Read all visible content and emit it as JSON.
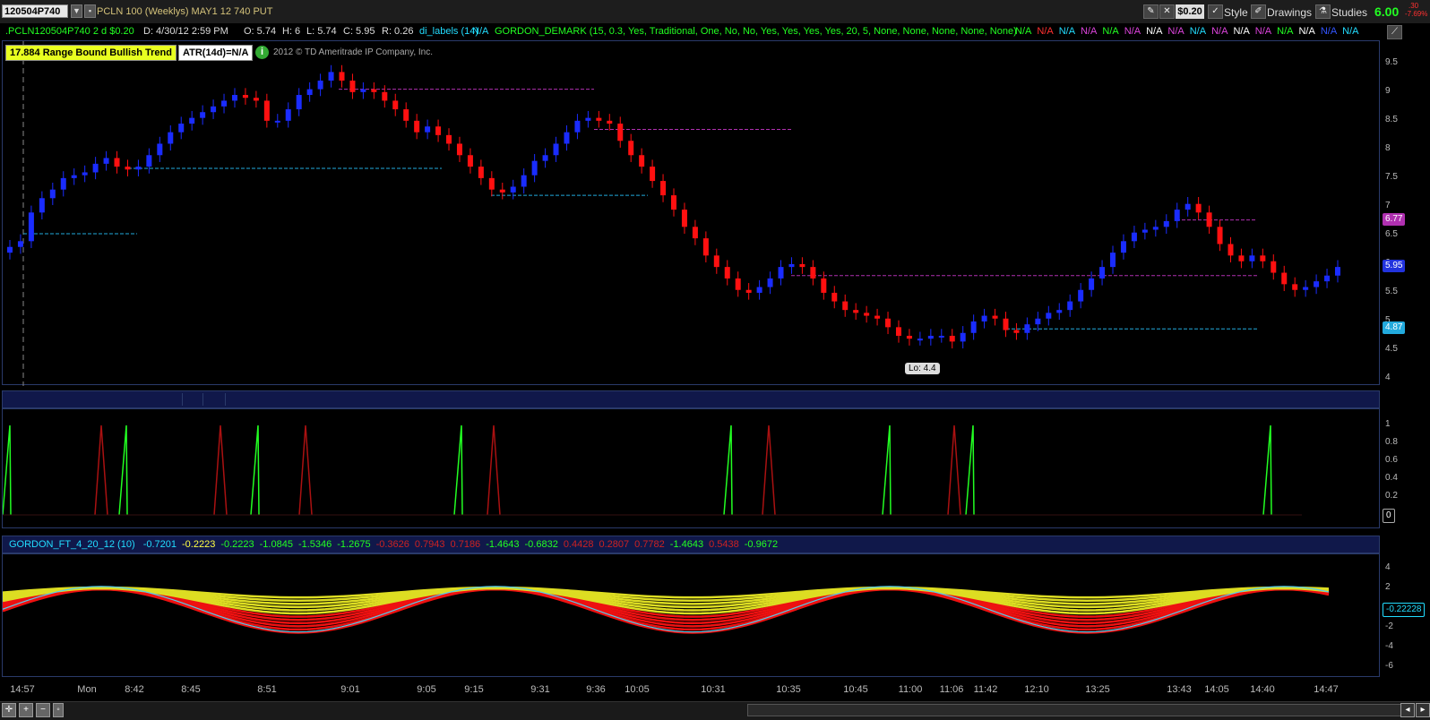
{
  "toolbar": {
    "symbol": "120504P740",
    "description": "PCLN 100 (Weeklys) MAY1 12 740 PUT",
    "price_chip": "$0.20",
    "style_label": "Style",
    "drawings_label": "Drawings",
    "studies_label": "Studies",
    "last_price": "6.00",
    "change_top": ".30",
    "change_pct": "-7.69%"
  },
  "labelbar": {
    "ohlc": ".PCLN120504P740 2 d $0.20",
    "date": "D: 4/30/12 2:59 PM",
    "open": "O: 5.74",
    "high": "H: 6",
    "low": "L: 5.74",
    "close": "C: 5.95",
    "range": "R: 0.26",
    "di_labels": "di_labels (14)",
    "di_value": "N/A",
    "demark": "GORDON_DEMARK (15, 0.3, Yes, Traditional, One, No, No, Yes, Yes, Yes, Yes, 20, 5, None, None, None, None, None)",
    "na_values": [
      "N/A",
      "N/A",
      "N/A",
      "N/A",
      "N/A",
      "N/A",
      "N/A",
      "N/A",
      "N/A",
      "N/A",
      "N/A",
      "N/A",
      "N/A",
      "N/A",
      "N/A",
      "N/A"
    ],
    "na_colors": [
      "#22ff22",
      "#ff3030",
      "#22ddff",
      "#dd44dd",
      "#22ff22",
      "#dd44dd",
      "#ffffff",
      "#dd44dd",
      "#22ddff",
      "#dd44dd",
      "#ffffff",
      "#dd44dd",
      "#22ff22",
      "#ffffff",
      "#3355ff",
      "#22ddff"
    ]
  },
  "bubbles": {
    "trend": "17.884 Range Bound Bullish Trend",
    "atr": "ATR(14d)=N/A",
    "copyright": "2012 © TD Ameritrade IP Company, Inc.",
    "low_label": "Lo: 4.4"
  },
  "price_axis": {
    "ticks": [
      "9.5",
      "9",
      "8.5",
      "8",
      "7.5",
      "7",
      "6.5",
      "6",
      "5.5",
      "5",
      "4.5",
      "4"
    ],
    "badges": [
      {
        "text": "6.77",
        "bg": "#b030b0"
      },
      {
        "text": "5.95",
        "bg": "#2233dd"
      },
      {
        "text": "4.87",
        "bg": "#22aadd"
      }
    ]
  },
  "signal_axis": {
    "ticks": [
      "1",
      "0.8",
      "0.6",
      "0.4",
      "0.2"
    ],
    "badge": "0"
  },
  "osc": {
    "title": "GORDON_FT_4_20_12 (10)",
    "values": [
      {
        "v": "-0.7201",
        "c": "#22ddff"
      },
      {
        "v": "-0.2223",
        "c": "#ffff44"
      },
      {
        "v": "-0.2223",
        "c": "#22ff22"
      },
      {
        "v": "-1.0845",
        "c": "#22ff22"
      },
      {
        "v": "-1.5346",
        "c": "#22ff22"
      },
      {
        "v": "-1.2675",
        "c": "#22ff22"
      },
      {
        "v": "-0.3626",
        "c": "#cc2222"
      },
      {
        "v": "0.7943",
        "c": "#cc2222"
      },
      {
        "v": "0.7186",
        "c": "#cc2222"
      },
      {
        "v": "-1.4643",
        "c": "#22ff22"
      },
      {
        "v": "-0.6832",
        "c": "#22ff22"
      },
      {
        "v": "0.4428",
        "c": "#cc2222"
      },
      {
        "v": "0.2807",
        "c": "#cc2222"
      },
      {
        "v": "0.7782",
        "c": "#cc2222"
      },
      {
        "v": "-1.4643",
        "c": "#22ff22"
      },
      {
        "v": "0.5438",
        "c": "#cc2222"
      },
      {
        "v": "-0.9672",
        "c": "#22ff22"
      }
    ],
    "axis_ticks": [
      "4",
      "2",
      "-2",
      "-4",
      "-6"
    ],
    "badge": "-0.22228"
  },
  "time_axis": [
    "14:57",
    "Mon",
    "8:42",
    "8:45",
    "8:51",
    "9:01",
    "9:05",
    "9:15",
    "9:31",
    "9:36",
    "10:05",
    "10:31",
    "10:35",
    "10:45",
    "11:00",
    "11:06",
    "11:42",
    "12:10",
    "13:25",
    "13:43",
    "14:05",
    "14:40",
    "14:47"
  ],
  "chart_data": {
    "type": "candlestick",
    "title": ".PCLN120504P740",
    "ylim": [
      4,
      9.7
    ],
    "closes": [
      6.3,
      6.4,
      6.9,
      7.15,
      7.3,
      7.5,
      7.55,
      7.6,
      7.75,
      7.85,
      7.7,
      7.65,
      7.7,
      7.9,
      8.1,
      8.3,
      8.45,
      8.55,
      8.65,
      8.75,
      8.85,
      8.95,
      8.9,
      8.85,
      8.5,
      8.5,
      8.7,
      8.95,
      9.05,
      9.2,
      9.35,
      9.2,
      9.0,
      9.05,
      9.0,
      8.85,
      8.7,
      8.5,
      8.3,
      8.4,
      8.25,
      8.1,
      7.9,
      7.7,
      7.5,
      7.3,
      7.25,
      7.35,
      7.55,
      7.8,
      7.9,
      8.1,
      8.3,
      8.5,
      8.55,
      8.5,
      8.45,
      8.15,
      7.9,
      7.7,
      7.45,
      7.2,
      6.95,
      6.65,
      6.45,
      6.15,
      5.95,
      5.75,
      5.55,
      5.5,
      5.6,
      5.75,
      5.95,
      6.0,
      5.95,
      5.75,
      5.5,
      5.35,
      5.2,
      5.15,
      5.1,
      5.05,
      4.9,
      4.75,
      4.7,
      4.7,
      4.75,
      4.75,
      4.65,
      4.8,
      5.0,
      5.1,
      5.05,
      4.85,
      4.8,
      4.95,
      5.05,
      5.15,
      5.2,
      5.35,
      5.55,
      5.75,
      5.95,
      6.2,
      6.4,
      6.55,
      6.6,
      6.65,
      6.75,
      6.95,
      7.05,
      6.9,
      6.65,
      6.35,
      6.15,
      6.05,
      6.15,
      6.05,
      5.85,
      5.65,
      5.55,
      5.6,
      5.7,
      5.8,
      5.95
    ]
  }
}
